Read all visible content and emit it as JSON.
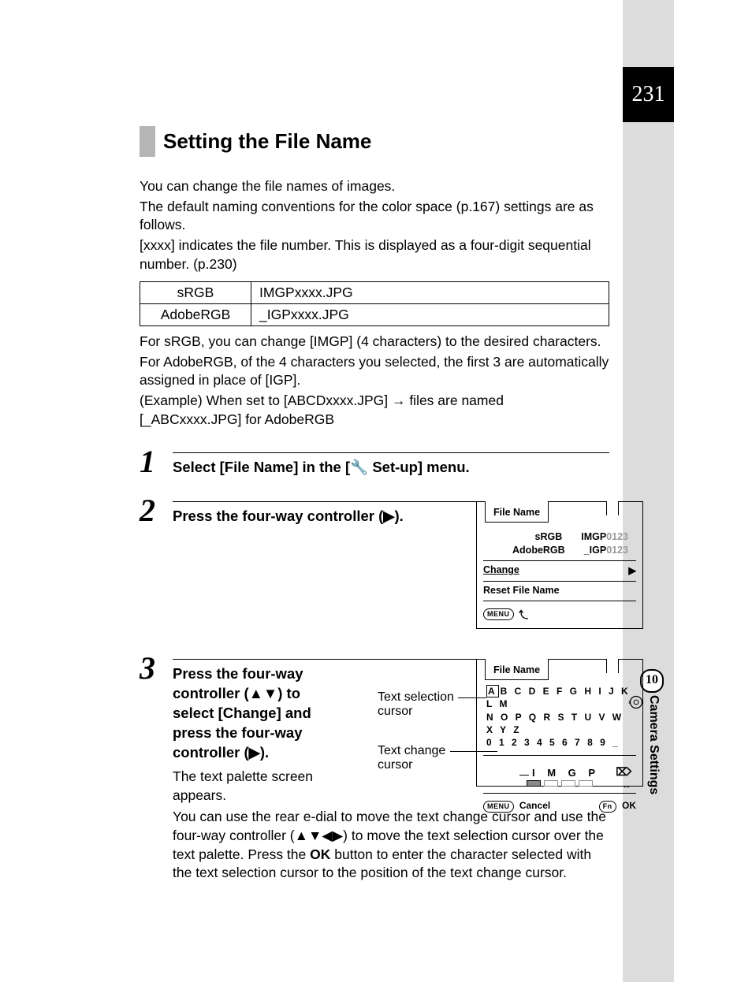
{
  "page_number": "231",
  "chapter_number": "10",
  "chapter_label": "Camera Settings",
  "heading": "Setting the File Name",
  "intro": {
    "p1": "You can change the file names of images.",
    "p2": "The default naming conventions for the color space (p.167) settings are as follows.",
    "p3": "[xxxx] indicates the file number. This is displayed as a four-digit sequential number. (p.230)"
  },
  "table": {
    "r1c1": "sRGB",
    "r1c2": "IMGPxxxx.JPG",
    "r2c1": "AdobeRGB",
    "r2c2": "_IGPxxxx.JPG"
  },
  "after_table": {
    "p1": "For sRGB, you can change [IMGP] (4 characters) to the desired characters.",
    "p2": "For AdobeRGB, of the 4 characters you selected, the first 3 are automatically assigned in place of [IGP].",
    "p3a": "(Example) When set to [ABCDxxxx.JPG] ",
    "p3_arrow": "→",
    "p3b": " files are named [_ABCxxxx.JPG] for AdobeRGB"
  },
  "steps": {
    "s1": {
      "num": "1",
      "title_a": "Select [File Name] in the [",
      "title_wrench": "🔧",
      "title_b": " Set-up] menu."
    },
    "s2": {
      "num": "2",
      "title": "Press the four-way controller (▶)."
    },
    "s3": {
      "num": "3",
      "title": "Press the four-way controller (▲▼) to select [Change] and press the four-way controller (▶).",
      "body": "The text palette screen appears."
    }
  },
  "panel1": {
    "title": "File Name",
    "row1_l": "sRGB",
    "row1_r_a": "IMGP",
    "row1_r_b": "0123",
    "row2_l": "AdobeRGB",
    "row2_r_a": "_IGP",
    "row2_r_b": "0123",
    "change": "Change",
    "reset": "Reset File Name",
    "menu": "MENU",
    "back": "⤴"
  },
  "panel2": {
    "title": "File Name",
    "line1_sel": "A",
    "line1_rest": "B C D E F G H I J K L M",
    "line2": "N O P Q R S T U V W X Y Z",
    "line3": "0 1 2 3 4 5 6 7 8 9 _",
    "entry": "I M G P",
    "del_icon": "⌦",
    "lr": "↔",
    "menu": "MENU",
    "cancel": "Cancel",
    "fn": "Fn",
    "ok": "OK"
  },
  "callouts": {
    "c1a": "Text selection",
    "c1b": "cursor",
    "c2a": "Text change",
    "c2b": "cursor"
  },
  "tail": {
    "p_a": "You can use the rear e-dial to move the text change cursor and use the four-way controller (▲▼◀▶) to move the text selection cursor over the text palette. Press the ",
    "ok": "OK",
    "p_b": " button to enter the character selected with the text selection cursor to the position of the text change cursor."
  }
}
